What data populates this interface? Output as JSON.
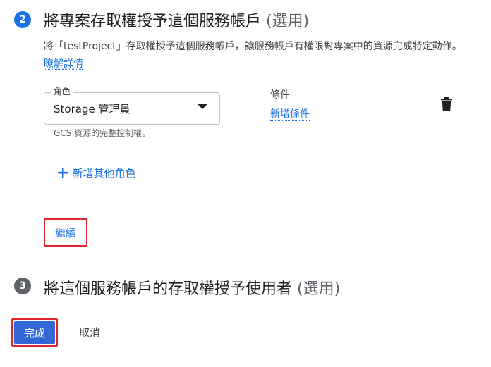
{
  "step2": {
    "number": "2",
    "title": "將專案存取權授予這個服務帳戶",
    "optional": "(選用)",
    "description": "將「testProject」存取權授予這個服務帳戶，讓服務帳戶有權限對專案中的資源完成特定動作。",
    "learn_more": "瞭解詳情",
    "role_label": "角色",
    "role_value": "Storage 管理員",
    "role_hint": "GCS 資源的完整控制權。",
    "condition_label": "條件",
    "add_condition": "新增條件",
    "add_role": "新增其他角色",
    "continue": "繼續"
  },
  "step3": {
    "number": "3",
    "title": "將這個服務帳戶的存取權授予使用者",
    "optional": "(選用)"
  },
  "footer": {
    "done": "完成",
    "cancel": "取消"
  },
  "icons": {
    "delete": "trash-icon",
    "add": "plus-icon",
    "dropdown": "caret-down-icon"
  },
  "colors": {
    "accent": "#1a73e8",
    "primary_button": "#3367d6",
    "highlight_border": "#e0262b"
  }
}
